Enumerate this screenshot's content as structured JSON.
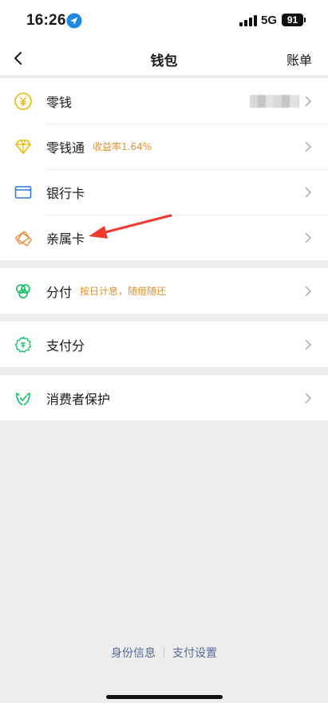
{
  "status": {
    "time": "16:26",
    "network": "5G",
    "battery": "91"
  },
  "nav": {
    "title": "钱包",
    "right": "账单"
  },
  "groups": [
    {
      "items": [
        {
          "label": "零钱",
          "tag": "",
          "icon": "yen-coin-icon"
        },
        {
          "label": "零钱通",
          "tag": "收益率1.64%",
          "icon": "diamond-icon"
        },
        {
          "label": "银行卡",
          "tag": "",
          "icon": "bank-card-icon"
        },
        {
          "label": "亲属卡",
          "tag": "",
          "icon": "family-card-icon"
        }
      ]
    },
    {
      "items": [
        {
          "label": "分付",
          "tag": "按日计息，随借随还",
          "icon": "fenfu-icon"
        }
      ]
    },
    {
      "items": [
        {
          "label": "支付分",
          "tag": "",
          "icon": "pay-score-icon"
        }
      ]
    },
    {
      "items": [
        {
          "label": "消费者保护",
          "tag": "",
          "icon": "consumer-protection-icon"
        }
      ]
    }
  ],
  "footer": {
    "identity": "身份信息",
    "settings": "支付设置"
  },
  "colors": {
    "accent_orange": "#e0932b",
    "link_blue": "#576b95",
    "green": "#07c160"
  }
}
